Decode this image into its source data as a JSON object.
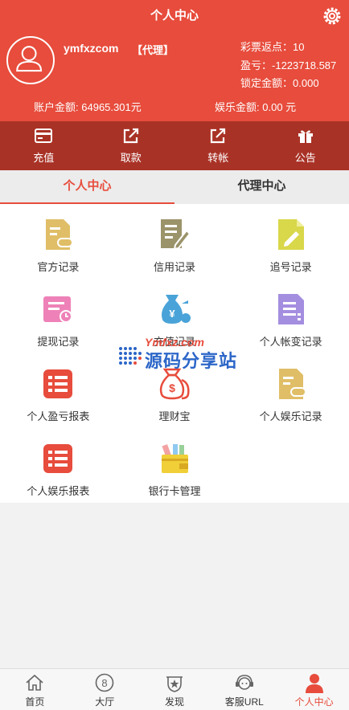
{
  "header": {
    "title": "个人中心"
  },
  "user": {
    "name": "ymfxzcom",
    "role": "【代理】"
  },
  "stats": [
    {
      "label": "彩票返点：",
      "value": "10"
    },
    {
      "label": "盈亏：",
      "value": "-1223718.587"
    },
    {
      "label": "锁定金额：",
      "value": "0.000"
    }
  ],
  "balances": {
    "account_label": "账户金额:",
    "account_value": "64965.301元",
    "entertainment_label": "娱乐金额:",
    "entertainment_value": "0.00 元"
  },
  "actions": [
    {
      "label": "充值",
      "icon": "card-icon"
    },
    {
      "label": "取款",
      "icon": "external-link-icon"
    },
    {
      "label": "转帐",
      "icon": "external-link-icon"
    },
    {
      "label": "公告",
      "icon": "gift-icon"
    }
  ],
  "tabs": [
    {
      "label": "个人中心",
      "active": true
    },
    {
      "label": "代理中心",
      "active": false
    }
  ],
  "menu": [
    {
      "label": "官方记录",
      "icon": "game-doc-icon",
      "color": "#e0be67"
    },
    {
      "label": "信用记录",
      "icon": "edit-doc-icon",
      "color": "#9b9369"
    },
    {
      "label": "追号记录",
      "icon": "pencil-doc-icon",
      "color": "#d9d74a"
    },
    {
      "label": "提现记录",
      "icon": "clock-doc-icon",
      "color": "#ee82b8"
    },
    {
      "label": "充值记录",
      "icon": "money-bag-icon",
      "color": "#4aa3d8"
    },
    {
      "label": "个人帐变记录",
      "icon": "list-doc-icon",
      "color": "#a48ee0"
    },
    {
      "label": "个人盈亏报表",
      "icon": "report-list-icon",
      "color": "#e74c3c"
    },
    {
      "label": "理财宝",
      "icon": "dollar-bag-icon",
      "color": "#e74c3c"
    },
    {
      "label": "个人娱乐记录",
      "icon": "game-doc-icon",
      "color": "#e0be67"
    },
    {
      "label": "个人娱乐报表",
      "icon": "report-list-icon",
      "color": "#e74c3c"
    },
    {
      "label": "银行卡管理",
      "icon": "wallet-icon",
      "color": "#f0cf38"
    }
  ],
  "watermark": {
    "top": "Ymfxz.com",
    "main": "源码分享站"
  },
  "bottom_nav": [
    {
      "label": "首页",
      "icon": "home-icon",
      "active": false
    },
    {
      "label": "大厅",
      "icon": "eight-ball-icon",
      "active": false
    },
    {
      "label": "发现",
      "icon": "badge-star-icon",
      "active": false
    },
    {
      "label": "客服URL",
      "icon": "headset-icon",
      "active": false
    },
    {
      "label": "个人中心",
      "icon": "person-icon",
      "active": true
    }
  ],
  "colors": {
    "primary": "#e74c3c",
    "primary_dark": "#a93226"
  }
}
